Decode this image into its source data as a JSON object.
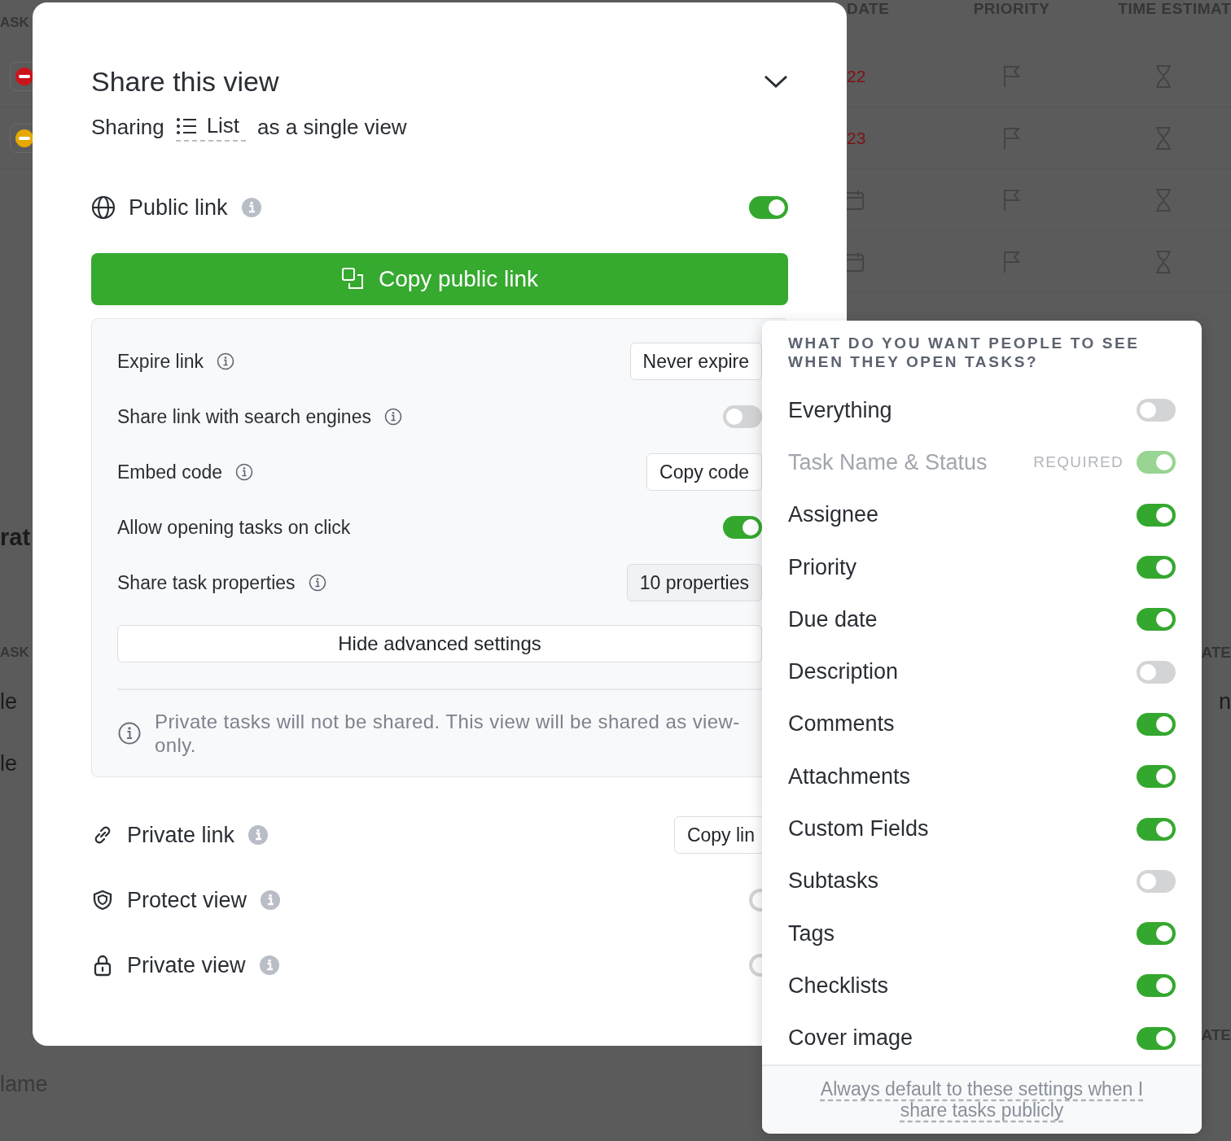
{
  "background": {
    "top_table": {
      "columns": [
        "ASK",
        "DATE",
        "PRIORITY",
        "TIME ESTIMAT"
      ],
      "rows": [
        {
          "kind": "dated",
          "color": "#c8151b",
          "due": "22"
        },
        {
          "kind": "dated",
          "color": "#e6a700",
          "due": "23"
        },
        {
          "kind": "undated"
        },
        {
          "kind": "undated"
        }
      ]
    },
    "section_title": "rat",
    "second_table": {
      "columns": [
        "ASK",
        "ATE"
      ],
      "rows": [
        [
          "le",
          "n"
        ],
        [
          "le"
        ]
      ]
    },
    "third_table_column": "ATE",
    "name_field": {
      "placeholder": "lame"
    }
  },
  "share_modal": {
    "title": "Share this view",
    "subtitle": {
      "prefix": "Sharing",
      "view": "List",
      "suffix": "as a single view"
    },
    "public_link": {
      "label": "Public link",
      "on": true,
      "button": "Copy public link"
    },
    "advanced": [
      {
        "kind": "button",
        "label": "Expire link",
        "info": true,
        "action": "Never expire"
      },
      {
        "kind": "toggle",
        "label": "Share link with search engines",
        "info": true,
        "on": false
      },
      {
        "kind": "button",
        "label": "Embed code",
        "info": true,
        "action": "Copy code"
      },
      {
        "kind": "toggle",
        "label": "Allow opening tasks on click",
        "info": false,
        "on": true
      },
      {
        "kind": "button",
        "label": "Share task properties",
        "info": true,
        "action": "10 properties"
      }
    ],
    "hide_button": "Hide advanced settings",
    "notice": "Private tasks will not be shared. This view will be shared as view-only.",
    "options": [
      {
        "kind": "link",
        "label": "Private link",
        "action": "Copy lin"
      },
      {
        "kind": "shield",
        "label": "Protect view",
        "on": false
      },
      {
        "kind": "lock",
        "label": "Private view",
        "on": false
      }
    ]
  },
  "popover": {
    "title": "WHAT DO YOU WANT PEOPLE TO SEE WHEN THEY OPEN TASKS?",
    "items": [
      {
        "label": "Everything",
        "on": false,
        "disabled": false
      },
      {
        "label": "Task Name & Status",
        "on": true,
        "disabled": true,
        "tag": "REQUIRED"
      },
      {
        "label": "Assignee",
        "on": true,
        "disabled": false
      },
      {
        "label": "Priority",
        "on": true,
        "disabled": false
      },
      {
        "label": "Due date",
        "on": true,
        "disabled": false
      },
      {
        "label": "Description",
        "on": false,
        "disabled": false
      },
      {
        "label": "Comments",
        "on": true,
        "disabled": false
      },
      {
        "label": "Attachments",
        "on": true,
        "disabled": false
      },
      {
        "label": "Custom Fields",
        "on": true,
        "disabled": false
      },
      {
        "label": "Subtasks",
        "on": false,
        "disabled": false
      },
      {
        "label": "Tags",
        "on": true,
        "disabled": false
      },
      {
        "label": "Checklists",
        "on": true,
        "disabled": false
      },
      {
        "label": "Cover image",
        "on": true,
        "disabled": false
      }
    ],
    "footer_link": "Always default to these settings when I share tasks publicly"
  }
}
